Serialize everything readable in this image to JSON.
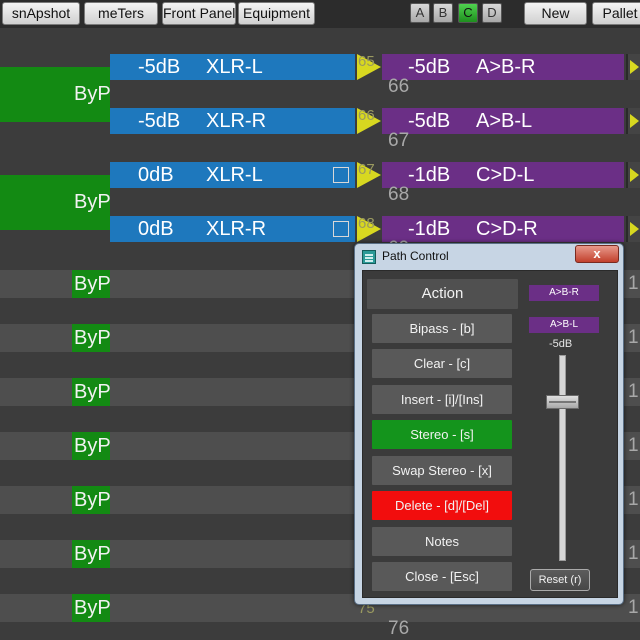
{
  "toolbar": {
    "snapshot": "snApshot",
    "meters": "meTers",
    "front_panel": "Front Panel",
    "equipment": "Equipment",
    "new": "New",
    "pallet": "Pallet",
    "selectors": [
      "A",
      "B",
      "C",
      "D"
    ],
    "active_selector": "C"
  },
  "routes": [
    {
      "byp": "ByP",
      "input_level": "-5dB",
      "input_channel": "XLR-L",
      "output_level": "-5dB",
      "output_route": "A>B-R",
      "number": "66",
      "arrow_number": "65",
      "has_checkbox": false
    },
    {
      "byp": "",
      "input_level": "-5dB",
      "input_channel": "XLR-R",
      "output_level": "-5dB",
      "output_route": "A>B-L",
      "number": "67",
      "arrow_number": "66",
      "has_checkbox": false
    },
    {
      "byp": "ByP",
      "input_level": "0dB",
      "input_channel": "XLR-L",
      "output_level": "-1dB",
      "output_route": "C>D-L",
      "number": "68",
      "arrow_number": "67",
      "has_checkbox": true
    },
    {
      "byp": "",
      "input_level": "0dB",
      "input_channel": "XLR-R",
      "output_level": "-1dB",
      "output_route": "C>D-R",
      "number": "69",
      "arrow_number": "68",
      "has_checkbox": true
    }
  ],
  "bypass_rows": [
    "ByP",
    "ByP",
    "ByP",
    "ByP",
    "ByP",
    "ByP",
    "ByP"
  ],
  "right_digits": [
    "1",
    "1",
    "1",
    "1",
    "1",
    "1",
    "1"
  ],
  "bottom_number": "76",
  "bottom_arrow_number": "75",
  "colors": {
    "bypass_green": "#138a13",
    "input_blue": "#1e78bd",
    "output_purple": "#6b2f86",
    "arrow_yellow": "#d8d820",
    "stereo_green": "#14941c",
    "delete_red": "#f20d0d"
  },
  "dialog": {
    "title": "Path Control",
    "close_glyph": "x",
    "action_header": "Action",
    "buttons": [
      "Bipass - [b]",
      "Clear - [c]",
      "Insert - [i]/[Ins]",
      "Stereo - [s]",
      "Swap Stereo - [x]",
      "Delete - [d]/[Del]",
      "Notes",
      "Close - [Esc]"
    ],
    "route_tags": [
      "A>B-R",
      "A>B-L"
    ],
    "fader_value": "-5dB",
    "fader_level_fraction": 0.77,
    "reset_label": "Reset (r)"
  }
}
